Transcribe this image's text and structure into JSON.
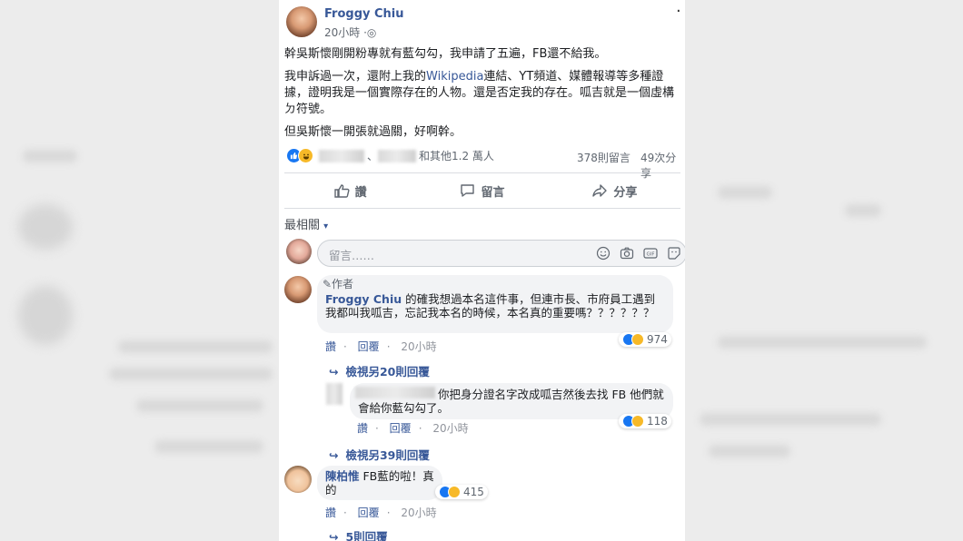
{
  "post": {
    "author": "Froggy Chiu",
    "time": "20小時",
    "globe": "·◎",
    "menu": "·",
    "paragraph1": "幹吳斯懷剛開粉專就有藍勾勾，我申請了五遍，FB還不給我。",
    "paragraph2_a": "我申訴過一次，還附上我的",
    "paragraph2_link": "Wikipedia",
    "paragraph2_b": "連結、YT頻道、媒體報導等多種證據，證明我是一個實際存在的人物。還是否定我的存在。呱吉就是一個虛構ㄉ符號。",
    "paragraph3": "但吳斯懷一開張就過關，好啊幹。",
    "reaction_sep": "、",
    "reaction_others": "和其他1.2 萬人",
    "comment_count": "378則留言",
    "share_count": "49次分享"
  },
  "actions": {
    "like": "讚",
    "comment": "留言",
    "share": "分享"
  },
  "sort": {
    "label": "最相關",
    "caret": "▾"
  },
  "comment_box": {
    "placeholder": "留言……"
  },
  "comments": [
    {
      "badge": "✎作者",
      "author": "Froggy Chiu",
      "text": " 的確我想過本名這件事，但連市長、市府員工遇到我都叫我呱吉，忘記我本名的時候，本名真的重要嗎？？？？？？",
      "like": "讚",
      "reply": "回覆",
      "time": "20小時",
      "reactions": "974",
      "view_replies": "檢視另20則回覆"
    },
    {
      "text": "你把身分證名字改成呱吉然後去找 FB 他們就會給你藍勾勾了。",
      "like": "讚",
      "reply": "回覆",
      "time": "20小時",
      "reactions": "118",
      "view_replies": "檢視另39則回覆"
    },
    {
      "author": "陳柏惟",
      "text": " FB藍的啦！真的",
      "like": "讚",
      "reply": "回覆",
      "time": "20小時",
      "reactions": "415",
      "view_replies": "5則回覆"
    }
  ],
  "colors": {
    "link": "#385898",
    "like": "#1877f2",
    "haha": "#f7b928",
    "bubble": "#f2f3f5"
  }
}
